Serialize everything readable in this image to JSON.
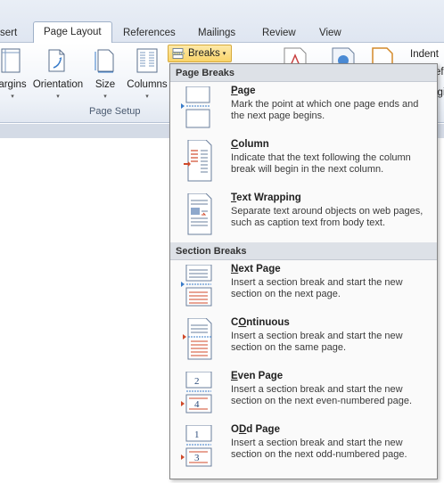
{
  "tabs": [
    {
      "label": "sert"
    },
    {
      "label": "Page Layout"
    },
    {
      "label": "References"
    },
    {
      "label": "Mailings"
    },
    {
      "label": "Review"
    },
    {
      "label": "View"
    }
  ],
  "ribbon": {
    "buttons": [
      {
        "label": "argins"
      },
      {
        "label": "Orientation"
      },
      {
        "label": "Size"
      },
      {
        "label": "Columns"
      }
    ],
    "group_label": "Page Setup",
    "breaks_label": "Breaks",
    "indent_label": "Indent",
    "left_partial": "ef",
    "right_partial": "igi"
  },
  "menu": {
    "page_breaks_header": "Page Breaks",
    "section_breaks_header": "Section Breaks",
    "items": [
      {
        "title_u": "P",
        "title_rest": "age",
        "desc": "Mark the point at which one page ends and the next page begins.",
        "icon": "page-break-icon"
      },
      {
        "title_u": "C",
        "title_rest": "olumn",
        "desc": "Indicate that the text following the column break will begin in the next column.",
        "icon": "column-break-icon"
      },
      {
        "title_u": "T",
        "title_rest": "ext Wrapping",
        "desc": "Separate text around objects on web pages, such as caption text from body text.",
        "icon": "text-wrapping-icon"
      },
      {
        "title_u": "N",
        "title_rest": "ext Page",
        "desc": "Insert a section break and start the new section on the next page.",
        "icon": "next-page-icon"
      },
      {
        "title_u": "O",
        "title_rest": "ntinuous",
        "title_pre": "C",
        "desc": "Insert a section break and start the new section on the same page.",
        "icon": "continuous-icon"
      },
      {
        "title_u": "E",
        "title_rest": "ven Page",
        "desc": "Insert a section break and start the new section on the next even-numbered page.",
        "icon": "even-page-icon"
      },
      {
        "title_u": "D",
        "title_rest": "d Page",
        "title_pre": "O",
        "desc": "Insert a section break and start the new section on the next odd-numbered page.",
        "icon": "odd-page-icon"
      }
    ]
  }
}
